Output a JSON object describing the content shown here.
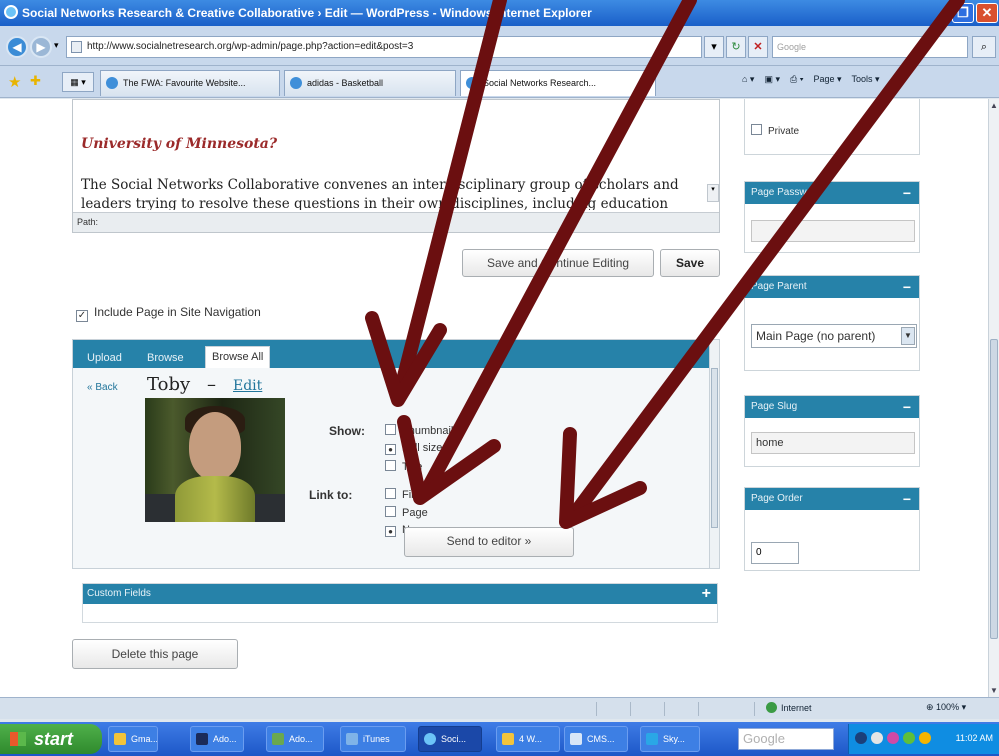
{
  "window": {
    "title": "Social Networks Research & Creative Collaborative › Edit — WordPress - Windows Internet Explorer",
    "url": "http://www.socialnetresearch.org/wp-admin/page.php?action=edit&post=3",
    "search_placeholder": "Google"
  },
  "tabs": [
    {
      "label": "The FWA: Favourite Website..."
    },
    {
      "label": "adidas - Basketball"
    },
    {
      "label": "Social Networks Research..."
    }
  ],
  "commandbar": {
    "page": "Page ▾",
    "tools": "Tools ▾"
  },
  "editor": {
    "question": "University of Minnesota?",
    "paragraph": "The Social Networks Collaborative convenes an interdisciplinary group of scholars and leaders trying to resolve these questions in their own disciplines, including education",
    "path_label": "Path:"
  },
  "buttons": {
    "save_continue": "Save and Continue Editing",
    "save": "Save",
    "send_to_editor": "Send to editor »",
    "delete_page": "Delete this page"
  },
  "include_nav": "Include Page in Site Navigation",
  "uploader": {
    "tabs": [
      "Upload",
      "Browse",
      "Browse All"
    ],
    "back": "« Back",
    "item_title": "Toby",
    "edit": "Edit",
    "show_label": "Show:",
    "link_label": "Link to:",
    "show_options": [
      "Thumbnail",
      "Full size",
      "Title"
    ],
    "show_selected": 1,
    "link_options": [
      "File",
      "Page",
      "None"
    ],
    "link_selected": 2
  },
  "custom_fields": "Custom Fields",
  "sidebar": {
    "private": "Private",
    "password_title": "Page Password",
    "password_value": "",
    "parent_title": "Page Parent",
    "parent_value": "Main Page (no parent)",
    "slug_title": "Page Slug",
    "slug_value": "home",
    "order_title": "Page Order",
    "order_value": "0"
  },
  "status": {
    "zone": "Internet",
    "zoom": "100%"
  },
  "taskbar": {
    "start": "start",
    "items": [
      "Gma...",
      "Ado...",
      "Ado...",
      "iTunes",
      "Soci...",
      "4 W...",
      "CMS...",
      "Sky..."
    ],
    "search_placeholder": "Google",
    "clock": "11:02 AM"
  },
  "colors": {
    "accent": "#2682a9",
    "arrow": "#6b0f10",
    "title_bar": "#1a5fc8"
  }
}
